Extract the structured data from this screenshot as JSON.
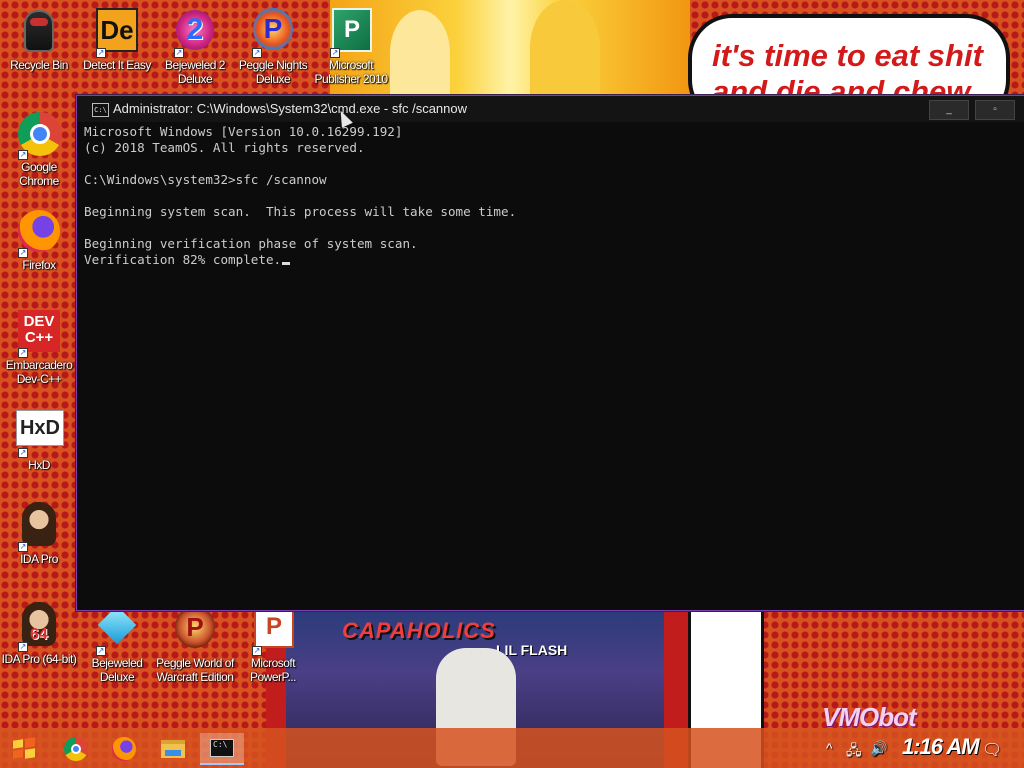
{
  "desktop": {
    "icons": [
      {
        "label": "Recycle Bin",
        "icon": "recycle-bin-icon"
      },
      {
        "label": "Detect It Easy",
        "icon": "detect-it-easy-icon"
      },
      {
        "label": "Bejeweled 2 Deluxe",
        "icon": "bejeweled-2-icon"
      },
      {
        "label": "Peggle Nights Deluxe",
        "icon": "peggle-nights-icon"
      },
      {
        "label": "Microsoft Publisher 2010",
        "icon": "publisher-icon"
      },
      {
        "label": "Google Chrome",
        "icon": "chrome-icon"
      },
      {
        "label": "Firefox",
        "icon": "firefox-icon"
      },
      {
        "label": "Embarcadero Dev-C++",
        "icon": "devcpp-icon"
      },
      {
        "label": "HxD",
        "icon": "hxd-icon"
      },
      {
        "label": "IDA Pro",
        "icon": "ida-pro-icon"
      },
      {
        "label": "IDA Pro (64-bit)",
        "icon": "ida-pro-64-icon"
      },
      {
        "label": "Bejeweled Deluxe",
        "icon": "bejeweled-icon"
      },
      {
        "label": "Peggle World of Warcraft Edition",
        "icon": "peggle-wow-icon"
      },
      {
        "label": "Microsoft PowerP...",
        "icon": "powerpoint-icon"
      }
    ],
    "glyphs": {
      "devcpp": "DEV\nC++",
      "hxd": "HxD",
      "ida64": "64",
      "detect": "De",
      "bejeweled2": "2",
      "peggle": "P"
    },
    "wallpaper": {
      "bubble_text": "it's time to eat shit and die and chew",
      "album_title": "CAPAHOLICS",
      "album_sub": "LIL FLASH",
      "watermark": "VMObot"
    }
  },
  "cmd": {
    "title": "Administrator: C:\\Windows\\System32\\cmd.exe - sfc /scannow",
    "icon_text": "C:\\",
    "minimize": "_",
    "maximize": "▫",
    "lines": [
      "Microsoft Windows [Version 10.0.16299.192]",
      "(c) 2018 TeamOS. All rights reserved.",
      "",
      "C:\\Windows\\system32>sfc /scannow",
      "",
      "Beginning system scan.  This process will take some time.",
      "",
      "Beginning verification phase of system scan.",
      "Verification 82% complete."
    ]
  },
  "taskbar": {
    "items": [
      {
        "name": "start-button",
        "icon": "windows-logo-icon"
      },
      {
        "name": "taskbar-chrome",
        "icon": "chrome-icon"
      },
      {
        "name": "taskbar-firefox",
        "icon": "firefox-icon"
      },
      {
        "name": "taskbar-file-explorer",
        "icon": "folder-icon"
      },
      {
        "name": "taskbar-cmd",
        "icon": "terminal-icon",
        "active": true
      }
    ],
    "tray": {
      "chevron": "^",
      "network": "🖧",
      "volume": "🔊",
      "notifications": "🗨"
    },
    "clock": "1:16 AM"
  },
  "colors": {
    "accent": "#7a3fae",
    "console_bg": "#0c0c0c",
    "console_fg": "#cccccc"
  }
}
